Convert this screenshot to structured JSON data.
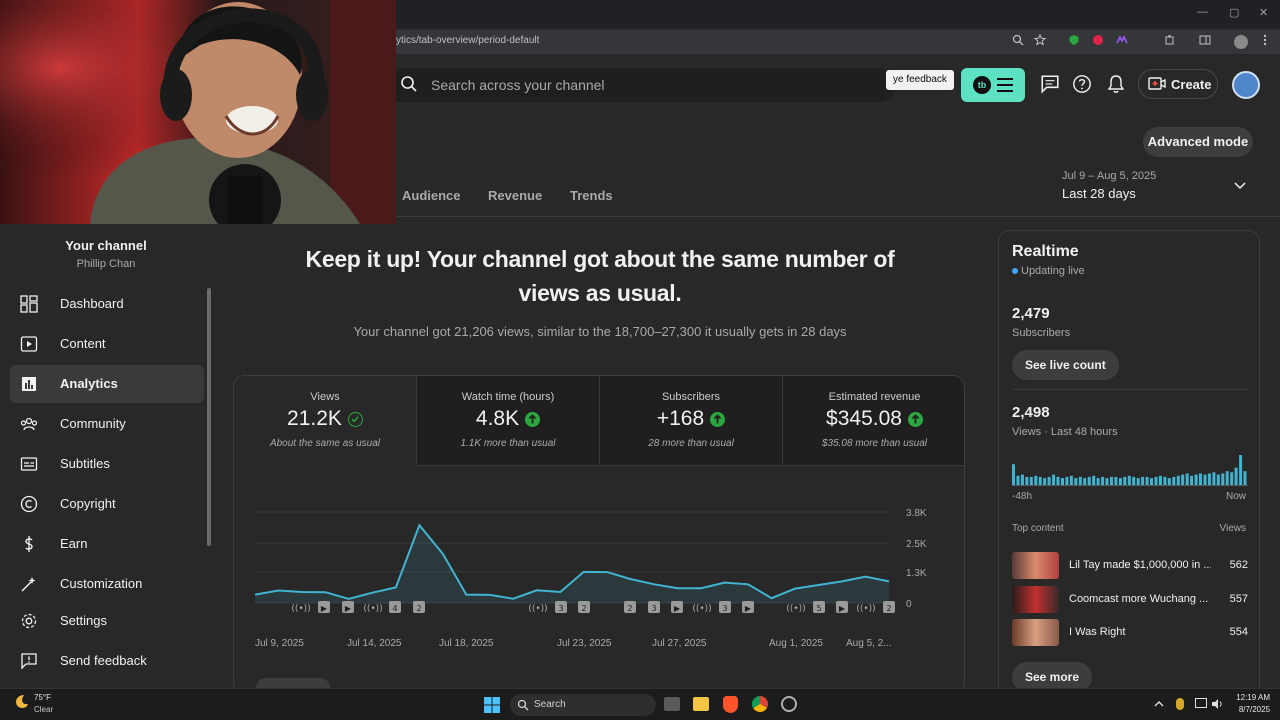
{
  "browser": {
    "url": "ytics/tab-overview/period-default",
    "window_controls": [
      "—",
      "▢",
      "✕"
    ]
  },
  "header": {
    "search_placeholder": "Search across your channel",
    "feedback_label": "ye feedback",
    "tubebuddy_logo": "tb",
    "create_label": "Create"
  },
  "toolbar": {
    "advanced_mode_label": "Advanced mode"
  },
  "tabs": [
    "Audience",
    "Revenue",
    "Trends"
  ],
  "period": {
    "range": "Jul 9 – Aug 5, 2025",
    "label": "Last 28 days"
  },
  "sidebar": {
    "channel_title": "Your channel",
    "channel_owner": "Phillip Chan",
    "items": [
      {
        "label": "Dashboard",
        "icon": "dashboard-icon"
      },
      {
        "label": "Content",
        "icon": "content-icon"
      },
      {
        "label": "Analytics",
        "icon": "analytics-icon",
        "active": true
      },
      {
        "label": "Community",
        "icon": "community-icon"
      },
      {
        "label": "Subtitles",
        "icon": "subtitles-icon"
      },
      {
        "label": "Copyright",
        "icon": "copyright-icon"
      },
      {
        "label": "Earn",
        "icon": "earn-icon"
      },
      {
        "label": "Customization",
        "icon": "customization-icon"
      }
    ],
    "footer_items": [
      {
        "label": "Settings",
        "icon": "settings-icon"
      },
      {
        "label": "Send feedback",
        "icon": "feedback-icon"
      }
    ]
  },
  "main": {
    "headline": "Keep it up! Your channel got about the same number of views as usual.",
    "subline": "Your channel got 21,206 views, similar to the 18,700–27,300 it usually gets in 28 days",
    "metrics": [
      {
        "label": "Views",
        "value": "21.2K",
        "note": "About the same as usual",
        "indicator": "check"
      },
      {
        "label": "Watch time (hours)",
        "value": "4.8K",
        "note": "1.1K more than usual",
        "indicator": "up"
      },
      {
        "label": "Subscribers",
        "value": "+168",
        "note": "28 more than usual",
        "indicator": "up"
      },
      {
        "label": "Estimated revenue",
        "value": "$345.08",
        "note": "$35.08 more than usual",
        "indicator": "up"
      }
    ]
  },
  "chart_data": {
    "type": "area",
    "x_tick_labels": [
      "Jul 9, 2025",
      "Jul 14, 2025",
      "Jul 18, 2025",
      "Jul 23, 2025",
      "Jul 27, 2025",
      "Aug 1, 2025",
      "Aug 5, 2..."
    ],
    "y_tick_labels": [
      "3.8K",
      "2.5K",
      "1.3K",
      "0"
    ],
    "ylim": [
      0,
      3800
    ],
    "x": [
      "Jul 9",
      "Jul 10",
      "Jul 11",
      "Jul 12",
      "Jul 13",
      "Jul 14",
      "Jul 15",
      "Jul 16",
      "Jul 17",
      "Jul 18",
      "Jul 19",
      "Jul 20",
      "Jul 21",
      "Jul 22",
      "Jul 23",
      "Jul 24",
      "Jul 25",
      "Jul 26",
      "Jul 27",
      "Jul 28",
      "Jul 29",
      "Jul 30",
      "Jul 31",
      "Aug 1",
      "Aug 2",
      "Aug 3",
      "Aug 4",
      "Aug 5"
    ],
    "values": [
      350,
      520,
      460,
      450,
      170,
      430,
      650,
      3250,
      2050,
      350,
      340,
      180,
      530,
      460,
      1300,
      1290,
      1000,
      780,
      620,
      620,
      850,
      780,
      200,
      600,
      750,
      900,
      1100,
      900
    ],
    "annotations": [
      "((•))",
      "▶",
      "▶",
      "((•))",
      "4",
      "2",
      "((•))",
      "3",
      "2",
      "2",
      "3",
      "▶",
      "((•))",
      "3",
      "▶",
      "((•))",
      "5",
      "▶",
      "((•))",
      "2"
    ],
    "grid": true,
    "series_color": "#41b4d2"
  },
  "realtime": {
    "title": "Realtime",
    "status": "Updating live",
    "subscribers_value": "2,479",
    "subscribers_label": "Subscribers",
    "live_count_label": "See live count",
    "views_value": "2,498",
    "views_label": "Views · Last 48 hours",
    "spark_left": "-48h",
    "spark_right": "Now",
    "spark_values": [
      18,
      8,
      9,
      7,
      7,
      8,
      7,
      6,
      7,
      9,
      7,
      6,
      7,
      8,
      6,
      7,
      6,
      7,
      8,
      6,
      7,
      6,
      7,
      7,
      6,
      7,
      8,
      7,
      6,
      7,
      7,
      6,
      7,
      8,
      7,
      6,
      7,
      8,
      9,
      10,
      8,
      9,
      10,
      9,
      10,
      11,
      9,
      10,
      12,
      11,
      15,
      26,
      12
    ],
    "top_content_label": "Top content",
    "views_col_label": "Views",
    "top_content": [
      {
        "title": "Lil Tay made $1,000,000 in ...",
        "views": "562"
      },
      {
        "title": "Coomcast more Wuchang ...",
        "views": "557"
      },
      {
        "title": "I Was Right",
        "views": "554"
      }
    ],
    "see_more_label": "See more"
  },
  "taskbar": {
    "temperature": "75°F",
    "condition": "Clear",
    "search_label": "Search",
    "time": "12:19 AM",
    "date": "8/7/2025"
  }
}
